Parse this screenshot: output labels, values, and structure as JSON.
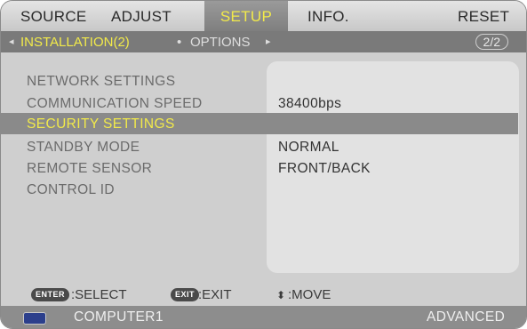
{
  "tabs": [
    {
      "label": "SOURCE"
    },
    {
      "label": "ADJUST"
    },
    {
      "label": "SETUP"
    },
    {
      "label": "INFO."
    },
    {
      "label": "RESET"
    }
  ],
  "subbar": {
    "left_arrow": "◂",
    "current": "INSTALLATION(2)",
    "dot": "•",
    "next": "OPTIONS",
    "right_arrow": "▸",
    "page": "2/2"
  },
  "menu": {
    "items": [
      {
        "label": "NETWORK SETTINGS",
        "value": ""
      },
      {
        "label": "COMMUNICATION SPEED",
        "value": "38400bps"
      },
      {
        "label": "SECURITY SETTINGS",
        "value": ""
      },
      {
        "label": "STANDBY MODE",
        "value": "NORMAL"
      },
      {
        "label": "REMOTE SENSOR",
        "value": "FRONT/BACK"
      },
      {
        "label": "CONTROL ID",
        "value": ""
      }
    ]
  },
  "guide": {
    "enter_key": "ENTER",
    "select": ":SELECT",
    "exit_key": "EXIT",
    "exit": ":EXIT",
    "move_icon": "⬍",
    "move": ":MOVE"
  },
  "status": {
    "source": "COMPUTER1",
    "mode": "ADVANCED"
  },
  "colors": {
    "highlight": "#f2ea4a",
    "selected_row": "#8a8a8a"
  }
}
